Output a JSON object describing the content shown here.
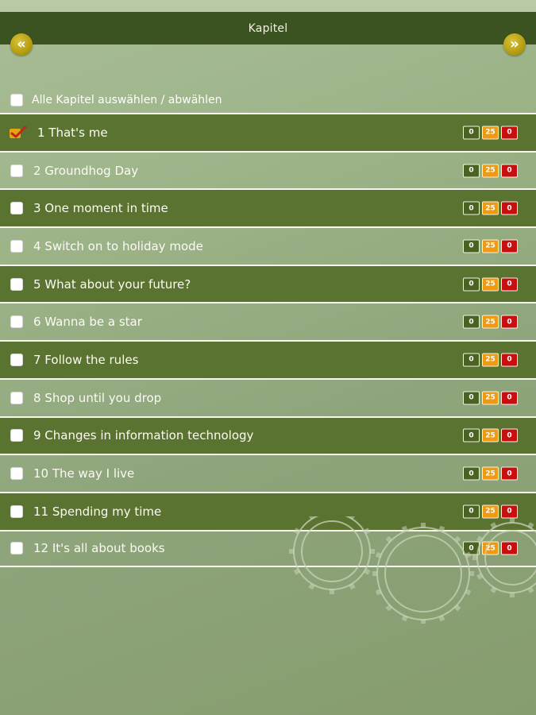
{
  "header": {
    "title": "Kapitel",
    "prev_icon": "double-chevron-left-icon",
    "prev_label": "«",
    "next_icon": "double-chevron-right-icon",
    "next_label": "»"
  },
  "select_all": {
    "label": "Alle Kapitel auswählen / abwählen",
    "checked": false
  },
  "chapters": [
    {
      "label": "1 That's me",
      "checked": true,
      "counts": [
        "0",
        "25",
        "0"
      ]
    },
    {
      "label": "2 Groundhog Day",
      "checked": false,
      "counts": [
        "0",
        "25",
        "0"
      ]
    },
    {
      "label": "3 One moment in time",
      "checked": false,
      "counts": [
        "0",
        "25",
        "0"
      ]
    },
    {
      "label": "4 Switch on to holiday mode",
      "checked": false,
      "counts": [
        "0",
        "25",
        "0"
      ]
    },
    {
      "label": "5 What about your future?",
      "checked": false,
      "counts": [
        "0",
        "25",
        "0"
      ]
    },
    {
      "label": "6 Wanna be a star",
      "checked": false,
      "counts": [
        "0",
        "25",
        "0"
      ]
    },
    {
      "label": "7 Follow the rules",
      "checked": false,
      "counts": [
        "0",
        "25",
        "0"
      ]
    },
    {
      "label": "8 Shop until you drop",
      "checked": false,
      "counts": [
        "0",
        "25",
        "0"
      ]
    },
    {
      "label": "9 Changes in information technology",
      "checked": false,
      "counts": [
        "0",
        "25",
        "0"
      ]
    },
    {
      "label": "10 The way I live",
      "checked": false,
      "counts": [
        "0",
        "25",
        "0"
      ]
    },
    {
      "label": "11 Spending my time",
      "checked": false,
      "counts": [
        "0",
        "25",
        "0"
      ]
    },
    {
      "label": "12 It's all about books",
      "checked": false,
      "counts": [
        "0",
        "25",
        "0"
      ]
    }
  ],
  "colors": {
    "header_bg": "#3a5321",
    "row_dark": "#5a7331",
    "nav_gold": "#b59d10",
    "counter_green": "#4b6322",
    "counter_orange": "#ef9a12",
    "counter_red": "#c80f10",
    "check_mark": "#e3a416"
  }
}
